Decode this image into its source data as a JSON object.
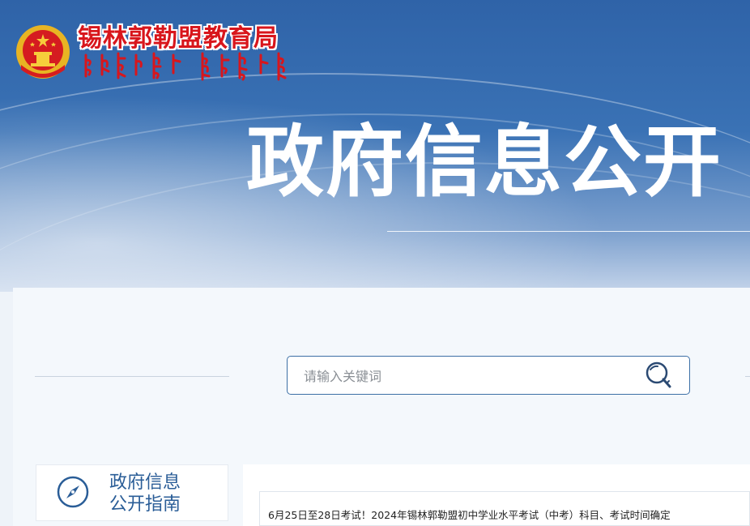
{
  "header": {
    "site_name": "锡林郭勒盟教育局",
    "emblem_icon": "national-emblem-icon",
    "mongolian_script_icon": "mongolian-script-name-icon"
  },
  "hero": {
    "title": "政府信息公开"
  },
  "search": {
    "placeholder": "请输入关键词",
    "icon": "search-icon"
  },
  "sidebar": {
    "guide_line1": "政府信息",
    "guide_line2": "公开指南",
    "guide_icon": "compass-icon"
  },
  "news": {
    "headline": "6月25日至28日考试！2024年锡林郭勒盟初中学业水平考试（中考）科目、考试时间确定"
  },
  "colors": {
    "banner_blue": "#2f63a8",
    "brand_red": "#d8161c",
    "link_blue": "#2a5d97"
  }
}
